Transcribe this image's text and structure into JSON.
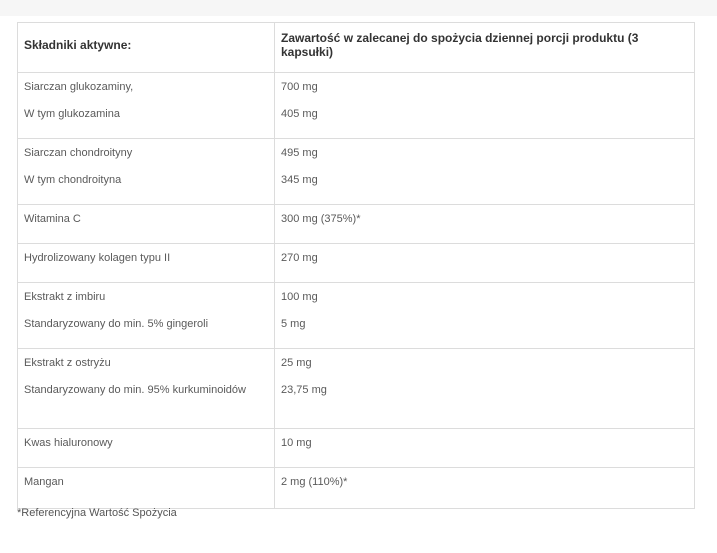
{
  "table": {
    "headers": [
      "Składniki aktywne:",
      "Zawartość w zalecanej do spożycia dziennej porcji produktu (3 kapsułki)"
    ],
    "rows": [
      {
        "ingredient": [
          "Siarczan glukozaminy,",
          "W tym glukozamina"
        ],
        "amount": [
          "700 mg",
          "405 mg"
        ]
      },
      {
        "ingredient": [
          "Siarczan chondroityny",
          "W tym chondroityna"
        ],
        "amount": [
          "495 mg",
          "345 mg"
        ]
      },
      {
        "ingredient": [
          "Witamina C"
        ],
        "amount": [
          "300 mg (375%)*"
        ]
      },
      {
        "ingredient": [
          "Hydrolizowany kolagen typu II"
        ],
        "amount": [
          "270 mg"
        ]
      },
      {
        "ingredient": [
          "Ekstrakt z imbiru",
          "Standaryzowany do min. 5% gingeroli"
        ],
        "amount": [
          "100 mg",
          "5 mg"
        ]
      },
      {
        "ingredient": [
          "Ekstrakt z ostryżu",
          "Standaryzowany do min. 95% kurkuminoidów"
        ],
        "amount": [
          "25 mg",
          "23,75 mg"
        ]
      },
      {
        "ingredient": [
          "Kwas hialuronowy"
        ],
        "amount": [
          "10 mg"
        ]
      },
      {
        "ingredient": [
          "Mangan"
        ],
        "amount": [
          "2 mg (110%)*"
        ]
      }
    ]
  },
  "footnote": "*Referencyjna Wartość Spożycia"
}
